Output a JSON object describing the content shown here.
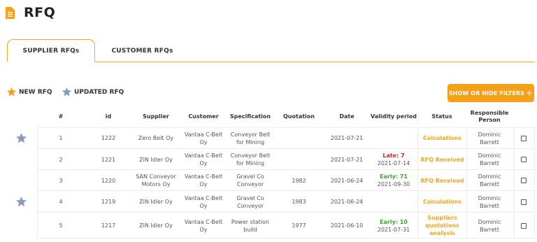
{
  "page": {
    "title": "RFQ",
    "icon": "document-icon"
  },
  "tabs": [
    {
      "label": "SUPPLIER RFQs",
      "active": true
    },
    {
      "label": "CUSTOMER RFQs",
      "active": false
    }
  ],
  "legend": {
    "new_label": "NEW RFQ",
    "updated_label": "UPDATED RFQ"
  },
  "filters_button": {
    "label": "SHOW OR HIDE FILTERS",
    "icon": "plus-icon"
  },
  "table": {
    "headers": {
      "num": "#",
      "id": "id",
      "supplier": "Supplier",
      "customer": "Customer",
      "specification": "Specification",
      "quotation": "Quotation",
      "date": "Date",
      "validity": "Validity period",
      "status": "Status",
      "responsible": "Responsible Person"
    },
    "rows": [
      {
        "star": true,
        "num": "1",
        "id": "1222",
        "supplier": "Zero Belt Oy",
        "customer": "Vantaa C-Belt Oy",
        "specification": "Conveyor Belt for Mining",
        "quotation": "",
        "date": "2021-07-21",
        "validity_line1": "",
        "validity_line2": "",
        "validity_kind": "",
        "status": "Calculations",
        "responsible": "Dominic Barrett",
        "checked": false
      },
      {
        "star": false,
        "num": "2",
        "id": "1221",
        "supplier": "ZiN Idler Oy",
        "customer": "Vantaa C-Belt Oy",
        "specification": "Conveyor Belt for Mining",
        "quotation": "",
        "date": "2021-07-21",
        "validity_line1": "Late: 7",
        "validity_line2": "2021-07-14",
        "validity_kind": "late",
        "status": "RFQ Received",
        "responsible": "Dominic Barrett",
        "checked": false
      },
      {
        "star": false,
        "num": "3",
        "id": "1220",
        "supplier": "SAN Conveyor Motors Oy",
        "customer": "Vantaa C-Belt Oy",
        "specification": "Gravel Co Conveyor",
        "quotation": "1982",
        "date": "2021-06-24",
        "validity_line1": "Early: 71",
        "validity_line2": "2021-09-30",
        "validity_kind": "early",
        "status": "RFQ Received",
        "responsible": "Dominic Barrett",
        "checked": false
      },
      {
        "star": true,
        "num": "4",
        "id": "1219",
        "supplier": "ZiN Idler Oy",
        "customer": "Vantaa C-Belt Oy",
        "specification": "Gravel Co Conveyor",
        "quotation": "1983",
        "date": "2021-06-24",
        "validity_line1": "",
        "validity_line2": "",
        "validity_kind": "",
        "status": "Calculations",
        "responsible": "Dominic Barrett",
        "checked": false
      },
      {
        "star": false,
        "num": "5",
        "id": "1217",
        "supplier": "ZiN Idler Oy",
        "customer": "Vantaa C-Belt Oy",
        "specification": "Power station build",
        "quotation": "1977",
        "date": "2021-06-10",
        "validity_line1": "Early: 10",
        "validity_line2": "2021-07-31",
        "validity_kind": "early",
        "status": "Suppliers quotations analysis",
        "responsible": "Dominic Barrett",
        "checked": false
      }
    ]
  },
  "colors": {
    "accent": "#f5a623",
    "star_new": "#f5a016",
    "star_updated": "#8b9dbd",
    "late": "#e02020",
    "early": "#3aa52f"
  }
}
